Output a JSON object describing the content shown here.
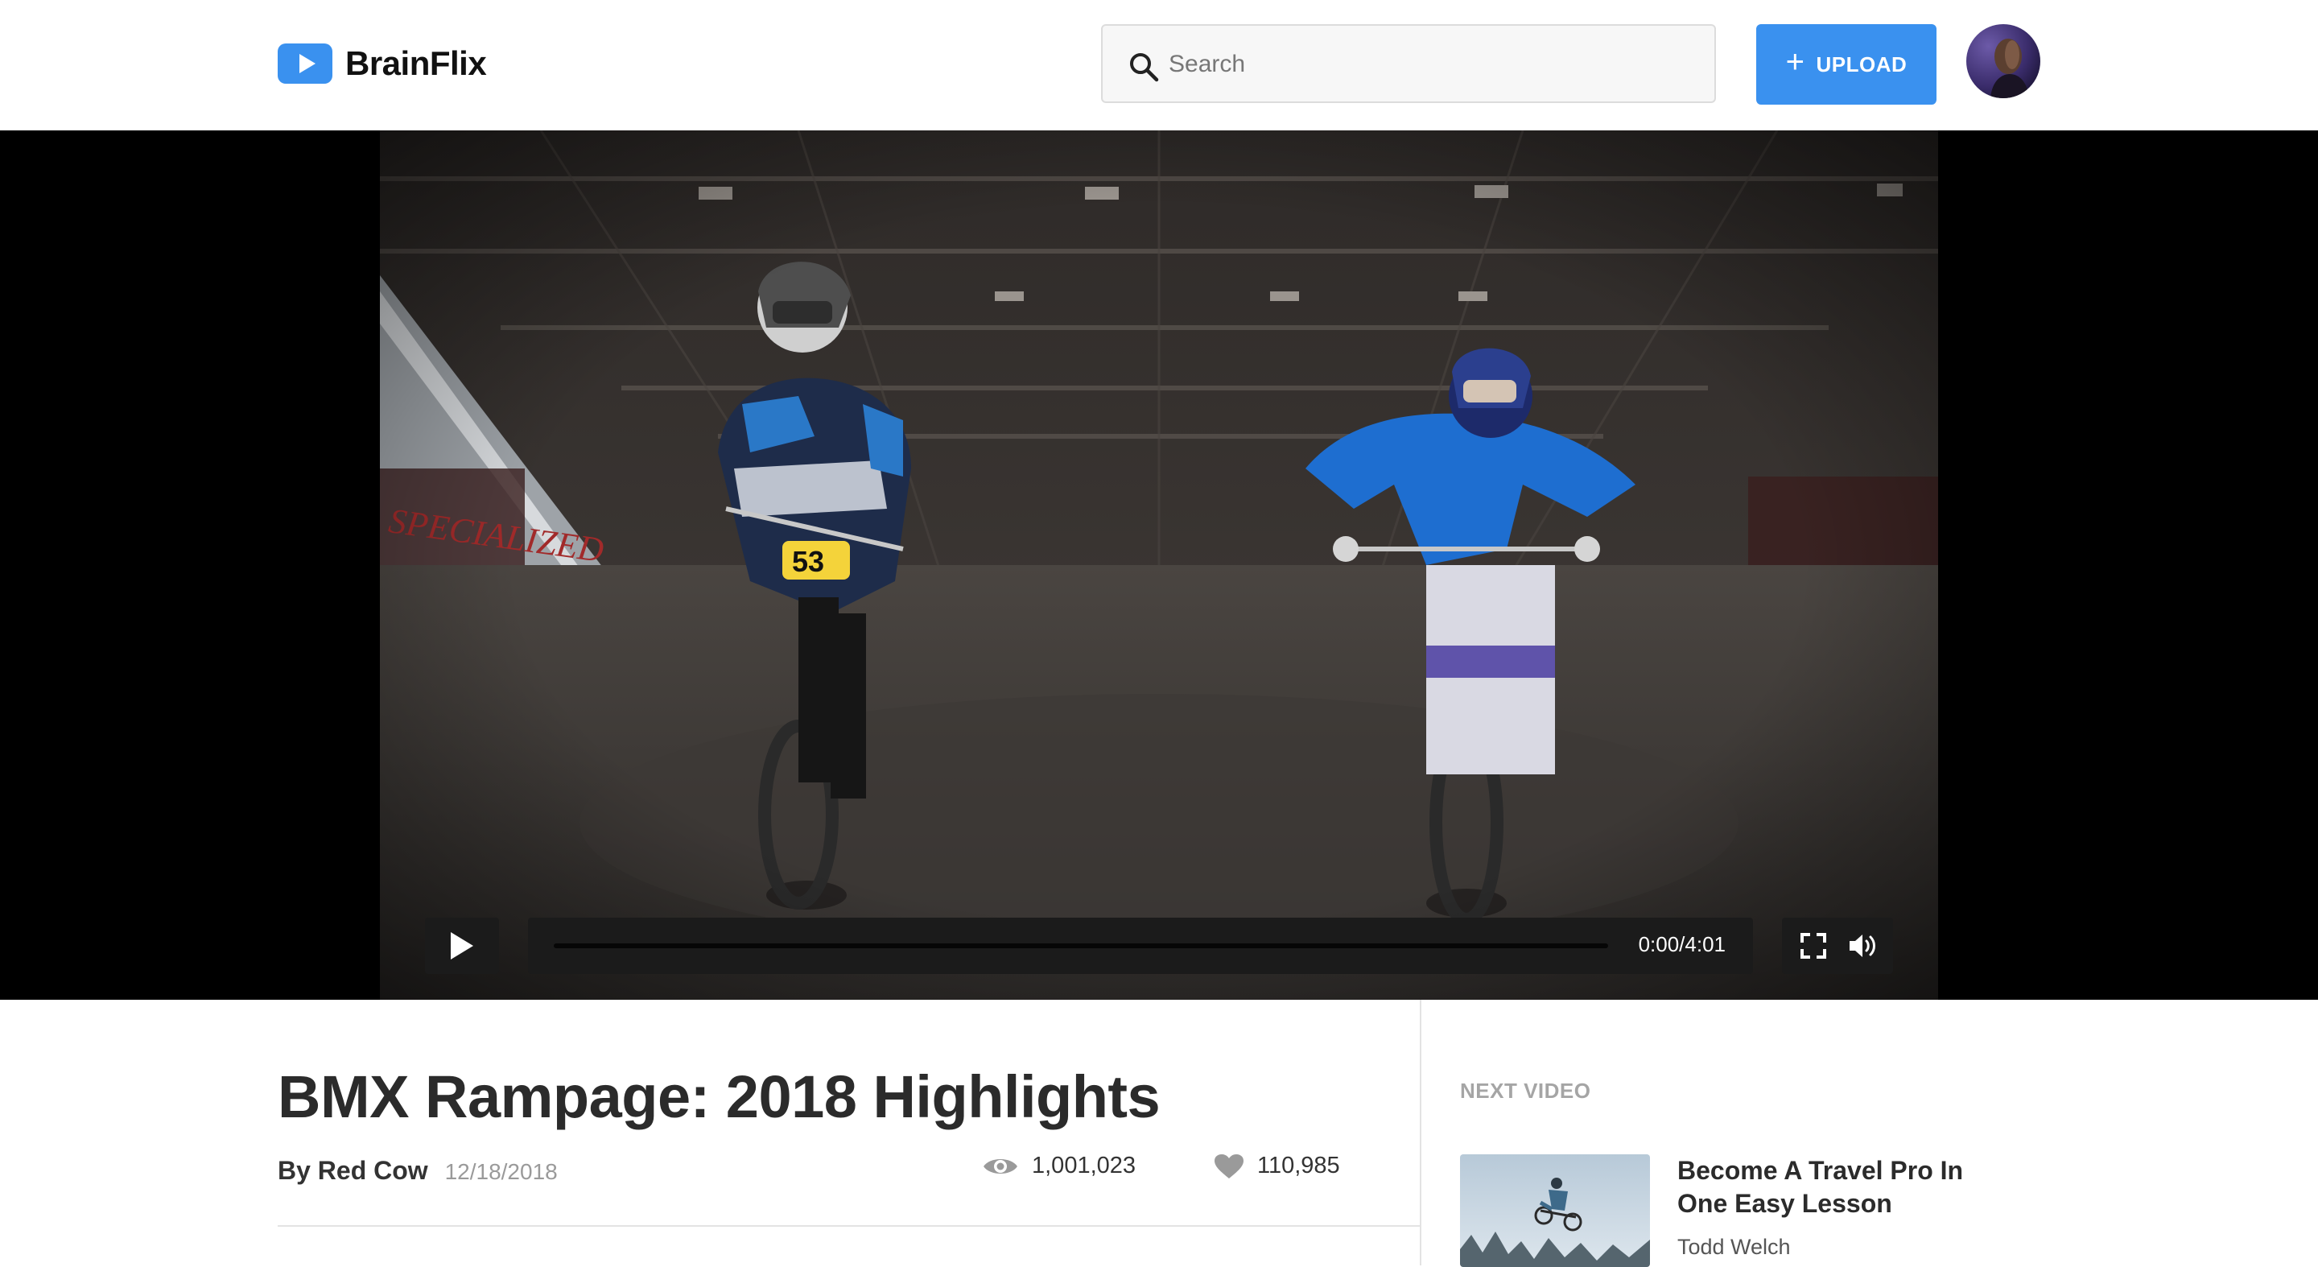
{
  "app": {
    "name": "BrainFlix"
  },
  "header": {
    "search_placeholder": "Search",
    "upload_label": "UPLOAD",
    "accent_color": "#3a91ef"
  },
  "player": {
    "time_display": "0:00/4:01",
    "progress": 0
  },
  "video": {
    "title": "BMX Rampage: 2018 Highlights",
    "author": "By Red Cow",
    "date": "12/18/2018",
    "views": "1,001,023",
    "likes": "110,985"
  },
  "sidebar": {
    "heading": "NEXT VIDEO",
    "next": {
      "title": "Become A Travel Pro In One Easy Lesson",
      "author": "Todd Welch"
    }
  },
  "icons": {
    "logo": "play-logo-icon",
    "search": "magnifier-icon",
    "upload": "plus-icon",
    "play": "play-icon",
    "fullscreen": "fullscreen-icon",
    "volume": "volume-icon",
    "views": "eye-icon",
    "likes": "heart-icon"
  }
}
